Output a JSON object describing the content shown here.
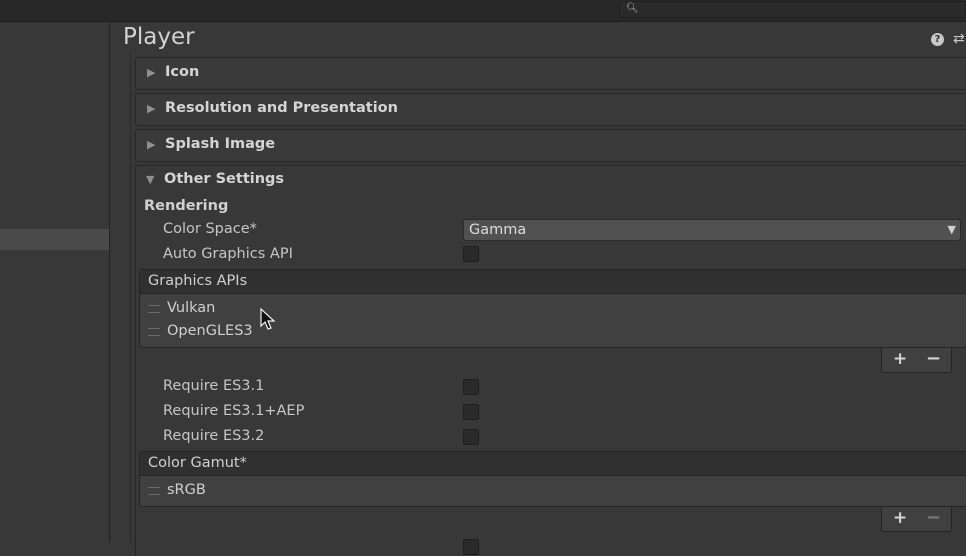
{
  "window": {
    "title": "Player"
  },
  "icons": {
    "search": "search-icon",
    "help": "help-icon",
    "presets": "presets-icon",
    "foldout_closed": "triangle-right-icon",
    "foldout_open": "triangle-down-icon",
    "dropdown": "chevron-down-icon",
    "drag": "drag-handle-icon",
    "add": "plus-icon",
    "remove": "minus-icon",
    "cursor": "mouse-pointer-icon"
  },
  "sections": [
    {
      "label": "Icon",
      "expanded": false
    },
    {
      "label": "Resolution and Presentation",
      "expanded": false
    },
    {
      "label": "Splash Image",
      "expanded": false
    },
    {
      "label": "Other Settings",
      "expanded": true
    }
  ],
  "rendering": {
    "heading": "Rendering",
    "color_space": {
      "label": "Color Space*",
      "value": "Gamma"
    },
    "auto_graphics_api": {
      "label": "Auto Graphics API",
      "checked": false
    }
  },
  "graphics_apis": {
    "header": "Graphics APIs",
    "items": [
      "Vulkan",
      "OpenGLES3"
    ],
    "add_label": "+",
    "remove_label": "−"
  },
  "requirements": [
    {
      "label": "Require ES3.1",
      "checked": false
    },
    {
      "label": "Require ES3.1+AEP",
      "checked": false
    },
    {
      "label": "Require ES3.2",
      "checked": false
    }
  ],
  "color_gamut": {
    "header": "Color Gamut*",
    "items": [
      "sRGB"
    ],
    "add_label": "+",
    "remove_label": "−",
    "remove_enabled": false
  },
  "colors": {
    "background": "#383838",
    "topbar": "#282828",
    "text": "#c6c6c6"
  }
}
